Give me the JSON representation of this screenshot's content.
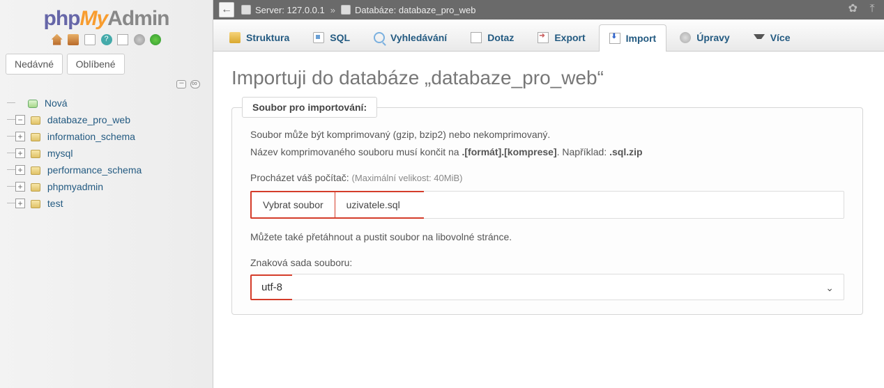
{
  "logo": {
    "p1": "php",
    "p2": "My",
    "p3": "Admin"
  },
  "sidebar": {
    "recent_label": "Nedávné",
    "favorites_label": "Oblíbené",
    "tree": {
      "new_label": "Nová",
      "items": [
        {
          "label": "databaze_pro_web",
          "expander": "−",
          "selected": true
        },
        {
          "label": "information_schema",
          "expander": "+"
        },
        {
          "label": "mysql",
          "expander": "+"
        },
        {
          "label": "performance_schema",
          "expander": "+"
        },
        {
          "label": "phpmyadmin",
          "expander": "+"
        },
        {
          "label": "test",
          "expander": "+"
        }
      ]
    }
  },
  "crumb": {
    "server_label": "Server:",
    "server_value": "127.0.0.1",
    "db_label": "Databáze:",
    "db_value": "databaze_pro_web"
  },
  "tabs": {
    "structure": "Struktura",
    "sql": "SQL",
    "search": "Vyhledávání",
    "query": "Dotaz",
    "export": "Export",
    "import": "Import",
    "operations": "Úpravy",
    "more": "Více"
  },
  "page": {
    "title": "Importuji do databáze „databaze_pro_web“",
    "fieldset_legend": "Soubor pro importování:",
    "line1": "Soubor může být komprimovaný (gzip, bzip2) nebo nekomprimovaný.",
    "line2_a": "Název komprimovaného souboru musí končit na ",
    "line2_b": ".[formát].[komprese]",
    "line2_c": ". Například: ",
    "line2_d": ".sql.zip",
    "browse_label": "Procházet váš počítač:",
    "browse_hint": "(Maximální velikost: 40MiB)",
    "choose_button": "Vybrat soubor",
    "chosen_file": "uzivatele.sql",
    "drag_hint": "Můžete také přetáhnout a pustit soubor na libovolné stránce.",
    "charset_label": "Znaková sada souboru:",
    "charset_value": "utf-8"
  }
}
